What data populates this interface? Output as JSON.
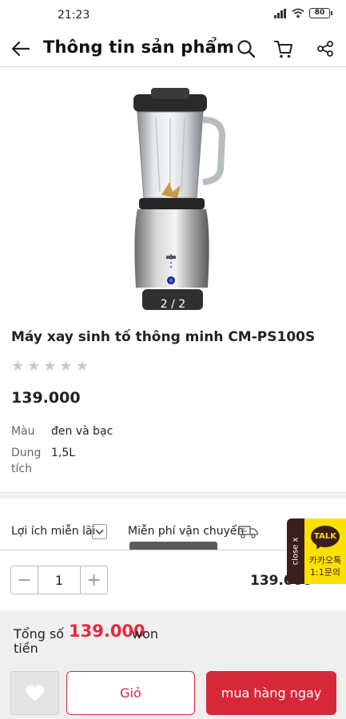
{
  "status_bar": {
    "time": "21:23",
    "battery": "80",
    "icons": [
      "signal-icon",
      "wifi-icon",
      "battery-icon"
    ]
  },
  "header": {
    "title": "Thông tin sản phẩm",
    "icons": [
      "back-arrow-icon",
      "search-icon",
      "cart-icon",
      "share-icon"
    ]
  },
  "product": {
    "image_counter": "2 / 2",
    "title": "Máy xay sinh tố thông minh CM-PS100S",
    "rating": 0,
    "rating_max": 5,
    "price": "139.000",
    "specs": [
      {
        "label_line1": "Màu",
        "label_line2": "",
        "value": "đen và bạc"
      },
      {
        "label_line1": "Dung",
        "label_line2": "tích",
        "value": "1,5L"
      }
    ]
  },
  "benefits": {
    "interest_free": "Lợi ích miễn lãi",
    "free_shipping": "Miễn phí vận chuyển"
  },
  "quantity": {
    "minus": "−",
    "value": "1",
    "plus": "+",
    "line_price": "139.000",
    "line_currency": "KRW"
  },
  "kakao": {
    "close": "close x",
    "bubble": "TALK",
    "line1": "카카오톡",
    "line2": "1:1문의"
  },
  "total": {
    "label_line1": "Tổng số",
    "label_line2": "tiền",
    "amount": "139.000",
    "currency": "won"
  },
  "actions": {
    "cart": "Giỏ",
    "buy": "mua hàng ngay"
  },
  "colors": {
    "accent": "#d7283a",
    "total_amount": "#e8283c",
    "kakao_yellow": "#fae100",
    "kakao_brown": "#3b1e1e"
  }
}
